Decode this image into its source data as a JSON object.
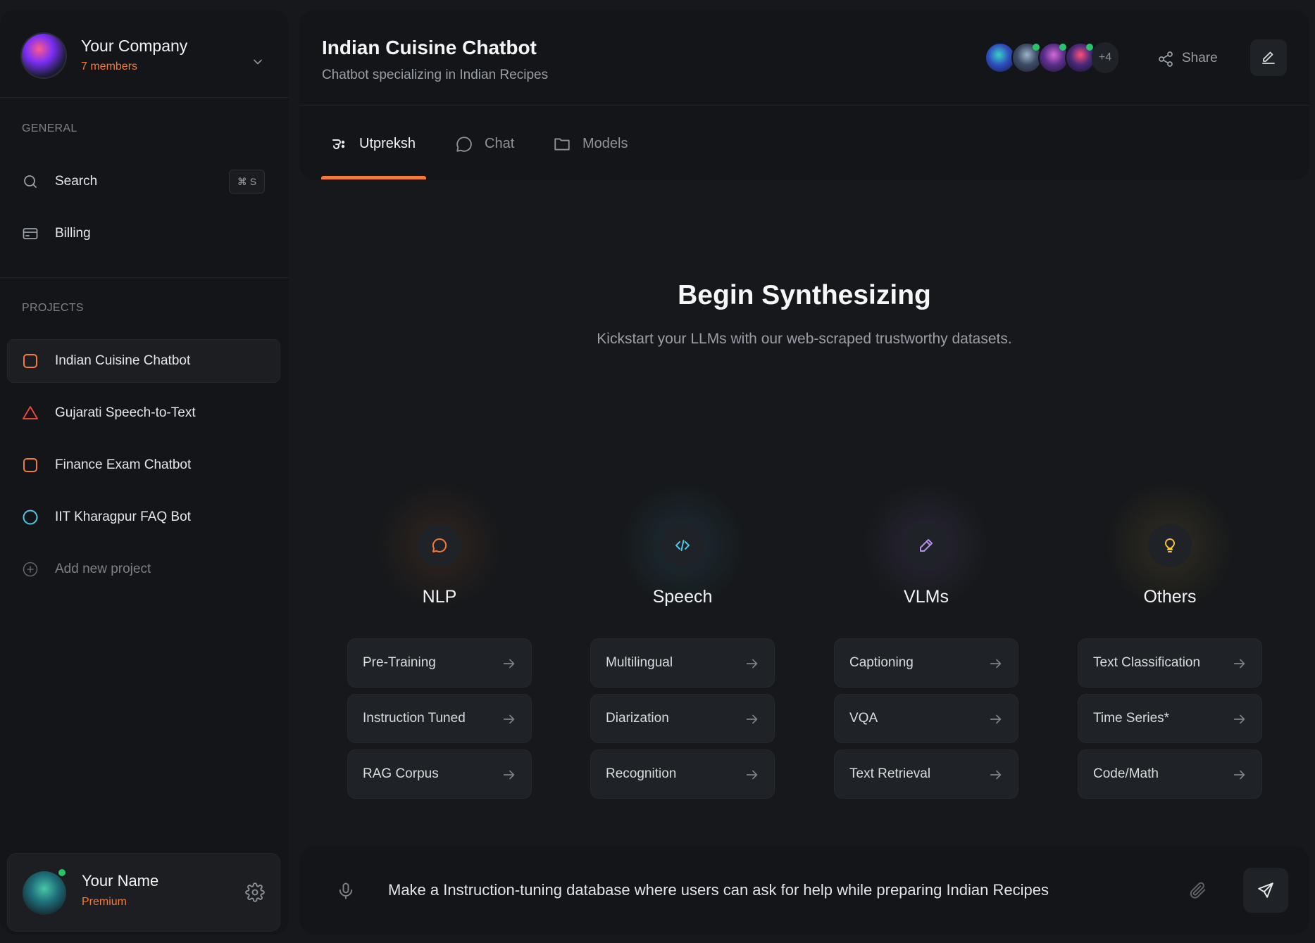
{
  "colors": {
    "accent": "#f37b35",
    "background": "#16181b",
    "panel": "#131518",
    "online": "#27c46b"
  },
  "workspace": {
    "name": "Your Company",
    "members": "7 members"
  },
  "sidebar": {
    "general_label": "GENERAL",
    "search_label": "Search",
    "search_shortcut": "⌘ S",
    "billing_label": "Billing",
    "projects_label": "PROJECTS",
    "projects": [
      {
        "label": "Indian Cuisine Chatbot",
        "icon": "square-icon",
        "color": "#f37b35",
        "active": true
      },
      {
        "label": "Gujarati Speech-to-Text",
        "icon": "triangle-icon",
        "color": "#e8453c",
        "active": false
      },
      {
        "label": "Finance Exam Chatbot",
        "icon": "square-icon",
        "color": "#f37b35",
        "active": false
      },
      {
        "label": "IIT Kharagpur FAQ Bot",
        "icon": "circle-icon",
        "color": "#4cc9e8",
        "active": false
      }
    ],
    "add_project_label": "Add new project"
  },
  "user": {
    "name": "Your Name",
    "plan": "Premium"
  },
  "header": {
    "title": "Indian Cuisine Chatbot",
    "subtitle": "Chatbot specializing in Indian Recipes",
    "collaborators_more": "+4",
    "share_label": "Share",
    "tabs": [
      {
        "label": "Utpreksh",
        "icon": "utpreksh-logo-icon",
        "active": true
      },
      {
        "label": "Chat",
        "icon": "chat-bubble-icon",
        "active": false
      },
      {
        "label": "Models",
        "icon": "folder-icon",
        "active": false
      }
    ]
  },
  "hero": {
    "title": "Begin Synthesizing",
    "subtitle": "Kickstart your LLMs with our web-scraped trustworthy datasets."
  },
  "categories": [
    {
      "title": "NLP",
      "icon": "chat-bubble-icon",
      "color": "#f37b35",
      "options": [
        "Pre-Training",
        "Instruction Tuned",
        "RAG Corpus"
      ]
    },
    {
      "title": "Speech",
      "icon": "code-icon",
      "color": "#4cc9e8",
      "options": [
        "Multilingual",
        "Diarization",
        "Recognition"
      ]
    },
    {
      "title": "VLMs",
      "icon": "pencil-icon",
      "color": "#b58cf0",
      "options": [
        "Captioning",
        "VQA",
        "Text Retrieval"
      ]
    },
    {
      "title": "Others",
      "icon": "lightbulb-icon",
      "color": "#f5c542",
      "options": [
        "Text Classification",
        "Time Series*",
        "Code/Math"
      ]
    }
  ],
  "composer": {
    "text": "Make a Instruction-tuning database where users can ask for help while preparing Indian Recipes"
  }
}
